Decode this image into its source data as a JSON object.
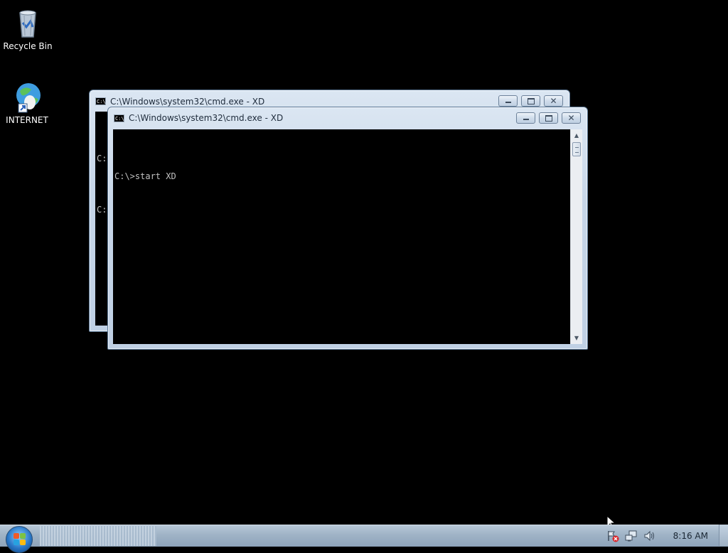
{
  "desktop": {
    "icons": [
      {
        "label": "Recycle Bin",
        "icon": "recycle-bin-icon"
      },
      {
        "label": "INTERNET",
        "icon": "internet-globe-icon"
      }
    ]
  },
  "windows": [
    {
      "title": "C:\\Windows\\system32\\cmd.exe - XD",
      "lines": [
        "C:",
        "C:"
      ],
      "state": "background"
    },
    {
      "title": "C:\\Windows\\system32\\cmd.exe - XD",
      "lines": [
        "C:\\>start XD"
      ],
      "state": "active"
    }
  ],
  "taskbar": {
    "clock": "8:16 AM",
    "tray_icons": [
      "action-center-flag-icon",
      "network-icon",
      "volume-icon"
    ]
  },
  "colors": {
    "desktop_background": "#000000",
    "console_background": "#000000",
    "console_text": "#c0c0c0",
    "window_frame": "#c7d6e8",
    "taskbar": "#9fb3c6"
  }
}
